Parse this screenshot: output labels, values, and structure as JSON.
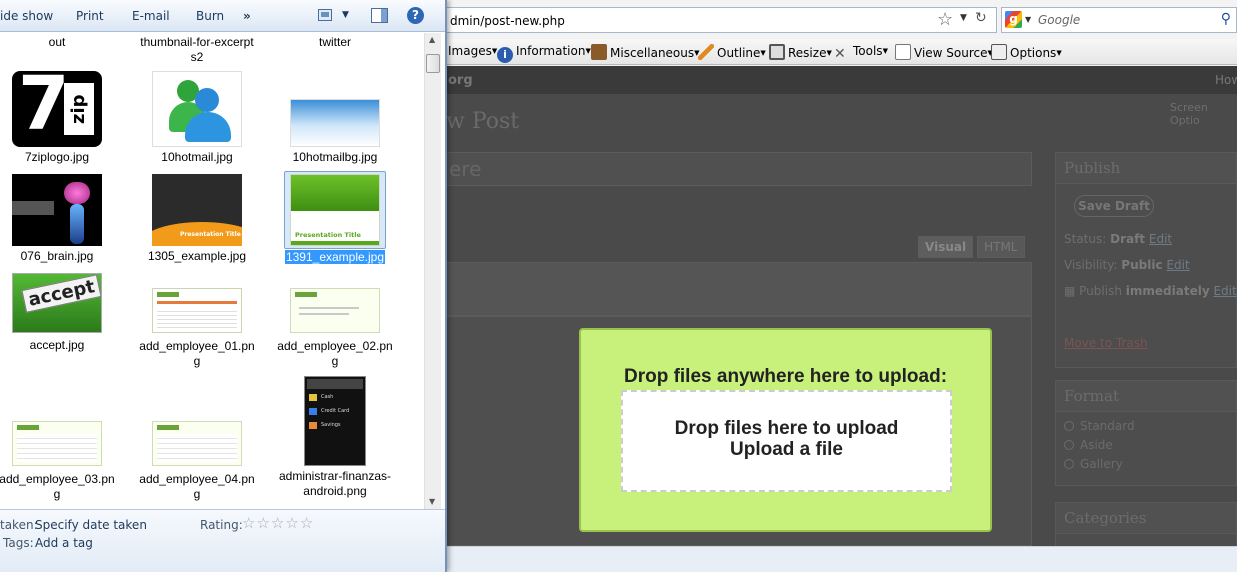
{
  "explorer": {
    "toolbar": {
      "slideshow": "ide show",
      "print": "Print",
      "email": "E-mail",
      "burn": "Burn",
      "more": "»"
    },
    "files": [
      {
        "name": "out"
      },
      {
        "name": "thumbnail-for-excerpts2"
      },
      {
        "name": "twitter"
      },
      {
        "name": "7ziplogo.jpg"
      },
      {
        "name": "10hotmail.jpg"
      },
      {
        "name": "10hotmailbg.jpg"
      },
      {
        "name": "076_brain.jpg"
      },
      {
        "name": "1305_example.jpg"
      },
      {
        "name": "1391_example.jpg"
      },
      {
        "name": "accept.jpg"
      },
      {
        "name": "add_employee_01.png"
      },
      {
        "name": "add_employee_02.png"
      },
      {
        "name": "add_employee_03.png"
      },
      {
        "name": "add_employee_04.png"
      },
      {
        "name": "administrar-finanzas-android.png"
      }
    ],
    "thumb_text": {
      "presentation_title": "Presentation Title",
      "accept": "accept",
      "seven": "7",
      "zip": "zip",
      "android_items": [
        "Cash",
        "Credit Card",
        "Savings"
      ]
    },
    "details": {
      "taken_label": "taken:",
      "taken_value": "Specify date taken",
      "rating_label": "Rating:",
      "tags_label": "Tags:",
      "tags_value": "Add a tag",
      "rating": 0,
      "rating_max": 5
    }
  },
  "browser": {
    "url": "dmin/post-new.php",
    "search_placeholder": "Google",
    "devbar": [
      {
        "label": "Images",
        "icon": "images-icon"
      },
      {
        "label": "Information",
        "icon": "info-icon"
      },
      {
        "label": "Miscellaneous",
        "icon": "misc-icon"
      },
      {
        "label": "Outline",
        "icon": "outline-icon"
      },
      {
        "label": "Resize",
        "icon": "resize-icon"
      },
      {
        "label": "Tools",
        "icon": "tools-icon"
      },
      {
        "label": "View Source",
        "icon": "source-icon"
      },
      {
        "label": "Options",
        "icon": "options-icon"
      }
    ],
    "wp": {
      "site": "org",
      "howdy": "How",
      "screen_options": "Screen Optio",
      "page_title": "w Post",
      "title_placeholder": "ere",
      "tab_visual": "Visual",
      "tab_html": "HTML",
      "publish_title": "Publish",
      "save_draft": "Save Draft",
      "status_label": "Status:",
      "status_value": "Draft",
      "visibility_label": "Visibility:",
      "visibility_value": "Public",
      "publish_label": "Publish",
      "publish_value": "immediately",
      "edit": "Edit",
      "move_to_trash": "Move to Trash",
      "format_title": "Format",
      "formats": [
        "Standard",
        "Aside",
        "Gallery"
      ],
      "categories_title": "Categories"
    },
    "upload": {
      "heading": "Drop files anywhere here to upload:",
      "drop_text": "Drop files here to upload",
      "upload_link": "Upload a file"
    }
  },
  "colors": {
    "overlay": "#c8f17b",
    "selection": "#3399ff"
  }
}
